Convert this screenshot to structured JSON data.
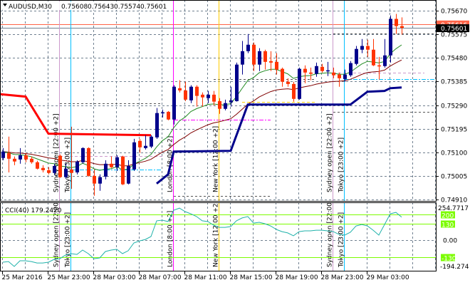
{
  "header": {
    "symbol": "AUDUSD,M30",
    "open": "0.75608",
    "high": "0.75643",
    "low": "0.75574",
    "close": "0.75601"
  },
  "cci_label": "CCI(40) 179.2420",
  "colors": {
    "bull": "#00008b",
    "bear": "#ff3300",
    "ma_fast": "#228b22",
    "ma_slow": "#800000",
    "stop_red": "#ff0000",
    "stop_navy": "#00008b",
    "grid": "#708090",
    "cci": "#20b2aa",
    "cci_level": "#7cfc00"
  },
  "price_axis": {
    "max": 0.7567,
    "min": 0.7491,
    "ticks": [
      "0.75670",
      "0.75575",
      "0.75480",
      "0.75385",
      "0.75290",
      "0.75195",
      "0.75100",
      "0.75005",
      "0.74910"
    ],
    "bid_tag": "0.75616",
    "last_tag": "0.75601"
  },
  "time_axis": [
    {
      "bar": 0,
      "label": "25 Mar 2016"
    },
    {
      "bar": 8,
      "label": "25 Mar 23:00"
    },
    {
      "bar": 16,
      "label": "28 Mar 03:00"
    },
    {
      "bar": 24,
      "label": "28 Mar 07:00"
    },
    {
      "bar": 32,
      "label": "28 Mar 11:00"
    },
    {
      "bar": 40,
      "label": "28 Mar 15:00"
    },
    {
      "bar": 48,
      "label": "28 Mar 19:00"
    },
    {
      "bar": 56,
      "label": "28 Mar 23:00"
    },
    {
      "bar": 64,
      "label": "29 Mar 03:00"
    }
  ],
  "sessions": [
    {
      "bar": 10,
      "label": "Sydney open  [22:00 +2]",
      "color": "#cc99cc"
    },
    {
      "bar": 12,
      "label": "Tokyo  [23:00 +2]",
      "color": "#00bfff"
    },
    {
      "bar": 30,
      "label": "London  [8:00 +2]",
      "color": "#ff00ff"
    },
    {
      "bar": 38,
      "label": "New York  [12:00 +2]",
      "color": "#ffcc00"
    },
    {
      "bar": 58,
      "label": "Sydney open  [22:00 +2]",
      "color": "#cc99cc"
    },
    {
      "bar": 60,
      "label": "Tokyo  [23:00 +2]",
      "color": "#00bfff"
    }
  ],
  "levels": [
    {
      "price": 0.75616,
      "from": -1,
      "to": 76,
      "color": "#ff6347",
      "dash": ""
    },
    {
      "price": 0.75601,
      "from": -1,
      "to": 76,
      "color": "#708090",
      "dash": ""
    },
    {
      "price": 0.75304,
      "from": 42,
      "to": 55,
      "color": "#ffcc00",
      "dash": "4,3"
    },
    {
      "price": 0.75232,
      "from": 30,
      "to": 47,
      "color": "#ff00ff",
      "dash": "6,2,2,2"
    },
    {
      "price": 0.75086,
      "from": 10,
      "to": 28,
      "color": "#cc99cc",
      "dash": "4,3"
    },
    {
      "price": 0.75421,
      "from": 58,
      "to": 74,
      "color": "#cc99cc",
      "dash": "4,3"
    },
    {
      "price": 0.75031,
      "from": 12,
      "to": 28,
      "color": "#00bfff",
      "dash": "6,2,2,2"
    },
    {
      "price": 0.75395,
      "from": 60,
      "to": 76,
      "color": "#00bfff",
      "dash": "6,2,2,2"
    },
    {
      "price": 0.75298,
      "from": 10,
      "to": 28,
      "color": "#555555",
      "dash": "3,3"
    },
    {
      "price": 0.75578,
      "from": 58,
      "to": 76,
      "color": "#555555",
      "dash": "3,3"
    },
    {
      "price": 0.75263,
      "from": 58,
      "to": 76,
      "color": "#555555",
      "dash": "3,3"
    },
    {
      "price": 0.75395,
      "from": 37,
      "to": 55,
      "color": "#555555",
      "dash": "3,3"
    },
    {
      "price": 0.74925,
      "from": 30,
      "to": 47,
      "color": "#555555",
      "dash": "3,3"
    }
  ],
  "stop_red": [
    [
      -1,
      0.75335
    ],
    [
      4,
      0.75324
    ],
    [
      8,
      0.75175
    ],
    [
      26,
      0.75169
    ]
  ],
  "stop_navy": [
    [
      27,
      0.74974
    ],
    [
      29,
      0.75011
    ],
    [
      30,
      0.75103
    ],
    [
      40,
      0.75106
    ],
    [
      43,
      0.75292
    ],
    [
      61,
      0.75292
    ],
    [
      64,
      0.75344
    ],
    [
      67,
      0.75347
    ],
    [
      68,
      0.75358
    ],
    [
      70,
      0.75361
    ]
  ],
  "cci_axis": {
    "max": 254.7717,
    "min": -194.274,
    "max_label": "254.7717",
    "min_label": "-194.274",
    "zero_label": "0.00",
    "levels": [
      200,
      130,
      -130
    ],
    "level_labels": [
      "200",
      "130",
      "-130"
    ]
  },
  "chart_data": {
    "type": "candlestick",
    "title": "AUDUSD,M30",
    "ylim": [
      0.7491,
      0.7567
    ],
    "candles_ohlc": [
      [
        0.75077,
        0.75117,
        0.75068,
        0.75103
      ],
      [
        0.75097,
        0.75163,
        0.75019,
        0.75074
      ],
      [
        0.75074,
        0.75083,
        0.75048,
        0.75063
      ],
      [
        0.75071,
        0.75117,
        0.75054,
        0.75088
      ],
      [
        0.75088,
        0.75097,
        0.7506,
        0.75071
      ],
      [
        0.75074,
        0.75083,
        0.75054,
        0.7506
      ],
      [
        0.7506,
        0.75066,
        0.75031,
        0.75034
      ],
      [
        0.75037,
        0.75048,
        0.75019,
        0.75028
      ],
      [
        0.75028,
        0.7504,
        0.75011,
        0.75017
      ],
      [
        0.75017,
        0.75054,
        0.75008,
        0.75045
      ],
      [
        0.75086,
        0.75091,
        0.74997,
        0.75
      ],
      [
        0.75,
        0.75054,
        0.74994,
        0.75034
      ],
      [
        0.75031,
        0.75203,
        0.74953,
        0.75017
      ],
      [
        0.75019,
        0.75068,
        0.75011,
        0.75063
      ],
      [
        0.7506,
        0.7512,
        0.75054,
        0.75117
      ],
      [
        0.75117,
        0.7512,
        0.75002,
        0.75005
      ],
      [
        0.75005,
        0.75031,
        0.74925,
        0.74974
      ],
      [
        0.74974,
        0.75011,
        0.74945,
        0.75
      ],
      [
        0.75002,
        0.75068,
        0.74991,
        0.75054
      ],
      [
        0.75054,
        0.75083,
        0.75037,
        0.7504
      ],
      [
        0.7504,
        0.75088,
        0.75025,
        0.7508
      ],
      [
        0.75083,
        0.75086,
        0.74968,
        0.74971
      ],
      [
        0.74974,
        0.75068,
        0.74971,
        0.75045
      ],
      [
        0.75031,
        0.75154,
        0.75025,
        0.7514
      ],
      [
        0.75146,
        0.75154,
        0.75097,
        0.7512
      ],
      [
        0.75117,
        0.75169,
        0.75111,
        0.75126
      ],
      [
        0.75123,
        0.75169,
        0.75117,
        0.75163
      ],
      [
        0.7516,
        0.75278,
        0.75154,
        0.75258
      ],
      [
        0.75258,
        0.75272,
        0.7524,
        0.75261
      ],
      [
        0.75263,
        0.75266,
        0.75229,
        0.75232
      ],
      [
        0.75232,
        0.7537,
        0.75212,
        0.75364
      ],
      [
        0.75358,
        0.7539,
        0.75341,
        0.75349
      ],
      [
        0.75349,
        0.75384,
        0.75306,
        0.75312
      ],
      [
        0.75309,
        0.7537,
        0.75298,
        0.75364
      ],
      [
        0.75364,
        0.7537,
        0.75284,
        0.75327
      ],
      [
        0.75332,
        0.75341,
        0.75284,
        0.75321
      ],
      [
        0.75318,
        0.75347,
        0.75298,
        0.75332
      ],
      [
        0.75332,
        0.75347,
        0.75289,
        0.75304
      ],
      [
        0.75306,
        0.75318,
        0.75255,
        0.75275
      ],
      [
        0.75275,
        0.75312,
        0.75269,
        0.75298
      ],
      [
        0.75301,
        0.75364,
        0.75284,
        0.75309
      ],
      [
        0.75306,
        0.75461,
        0.75304,
        0.75453
      ],
      [
        0.75453,
        0.75548,
        0.75413,
        0.75507
      ],
      [
        0.75507,
        0.75576,
        0.75499,
        0.75533
      ],
      [
        0.75533,
        0.75542,
        0.75427,
        0.75453
      ],
      [
        0.75453,
        0.75519,
        0.75427,
        0.75507
      ],
      [
        0.75507,
        0.75513,
        0.75433,
        0.75464
      ],
      [
        0.75467,
        0.75507,
        0.75427,
        0.75461
      ],
      [
        0.75464,
        0.75499,
        0.75413,
        0.75433
      ],
      [
        0.75436,
        0.75441,
        0.75364,
        0.75384
      ],
      [
        0.75384,
        0.75398,
        0.75364,
        0.75375
      ],
      [
        0.75375,
        0.75384,
        0.75304,
        0.75315
      ],
      [
        0.75315,
        0.75441,
        0.75312,
        0.75436
      ],
      [
        0.75436,
        0.7545,
        0.75378,
        0.75421
      ],
      [
        0.75421,
        0.75441,
        0.7539,
        0.75416
      ],
      [
        0.75416,
        0.75461,
        0.75404,
        0.75447
      ],
      [
        0.75444,
        0.75456,
        0.75421,
        0.75427
      ],
      [
        0.75427,
        0.75464,
        0.75407,
        0.7543
      ],
      [
        0.75421,
        0.75441,
        0.75398,
        0.7541
      ],
      [
        0.75413,
        0.75421,
        0.75364,
        0.75398
      ],
      [
        0.75395,
        0.75433,
        0.75384,
        0.75413
      ],
      [
        0.7541,
        0.75467,
        0.75404,
        0.75459
      ],
      [
        0.75456,
        0.75528,
        0.7545,
        0.75516
      ],
      [
        0.75513,
        0.75556,
        0.75499,
        0.75528
      ],
      [
        0.75528,
        0.75553,
        0.75484,
        0.75513
      ],
      [
        0.75513,
        0.75556,
        0.75447,
        0.7545
      ],
      [
        0.7545,
        0.75484,
        0.75393,
        0.75447
      ],
      [
        0.75447,
        0.75556,
        0.75441,
        0.7549
      ],
      [
        0.7549,
        0.75651,
        0.75461,
        0.75637
      ],
      [
        0.75637,
        0.75657,
        0.75576,
        0.75608
      ],
      [
        0.75608,
        0.75643,
        0.75574,
        0.75601
      ]
    ],
    "cci_values": [
      -167,
      -162,
      -200,
      -156,
      -156,
      -162,
      -173,
      -173,
      -167,
      -145,
      -140,
      -112,
      -101,
      -107,
      -74,
      -101,
      -140,
      -134,
      -85,
      -74,
      -68,
      -101,
      -79,
      -19,
      -3,
      8,
      30,
      151,
      156,
      145,
      233,
      249,
      222,
      205,
      184,
      151,
      145,
      118,
      101,
      101,
      107,
      151,
      173,
      184,
      134,
      140,
      129,
      112,
      85,
      68,
      58,
      36,
      68,
      74,
      74,
      79,
      79,
      74,
      68,
      47,
      41,
      63,
      112,
      123,
      112,
      79,
      41,
      123,
      205,
      216,
      179.24
    ]
  }
}
